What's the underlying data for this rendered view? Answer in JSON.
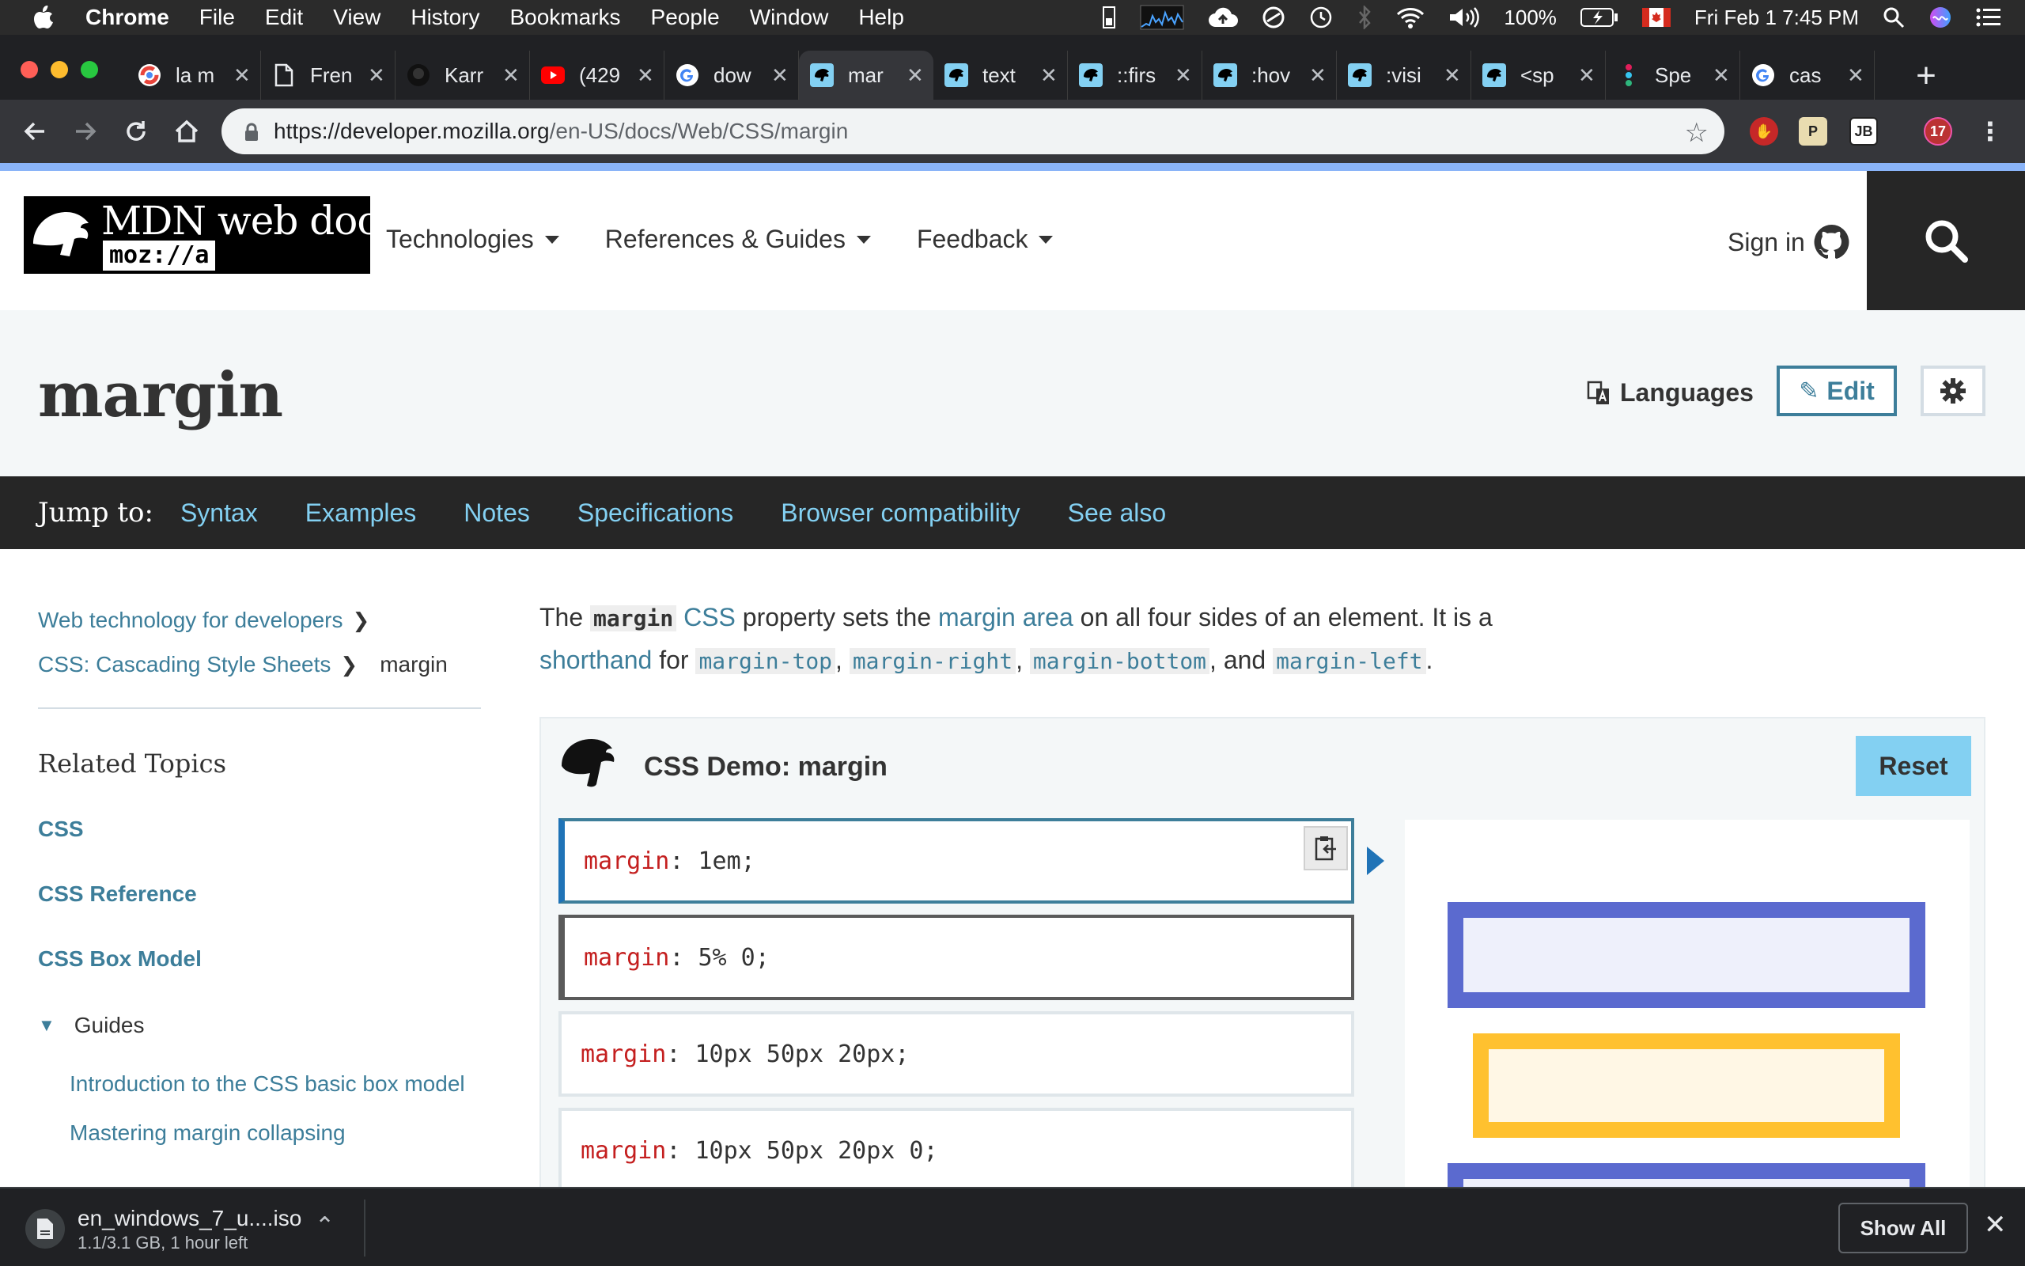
{
  "menubar": {
    "app_name": "Chrome",
    "menus": [
      "File",
      "Edit",
      "View",
      "History",
      "Bookmarks",
      "People",
      "Window",
      "Help"
    ],
    "battery": "100%",
    "datetime": "Fri Feb 1  7:45 PM"
  },
  "tabs": [
    {
      "label": "la m",
      "icon": "chrome-icon"
    },
    {
      "label": "Fren",
      "icon": "document-icon"
    },
    {
      "label": "Karr",
      "icon": "github-icon"
    },
    {
      "label": "(429",
      "icon": "youtube-icon"
    },
    {
      "label": "dow",
      "icon": "google-icon"
    },
    {
      "label": "mar",
      "icon": "mdn-icon",
      "active": true
    },
    {
      "label": "text",
      "icon": "mdn-icon"
    },
    {
      "label": "::firs",
      "icon": "mdn-icon"
    },
    {
      "label": ":hov",
      "icon": "mdn-icon"
    },
    {
      "label": ":visi",
      "icon": "mdn-icon"
    },
    {
      "label": "<sp",
      "icon": "mdn-icon"
    },
    {
      "label": "Spe",
      "icon": "slack-icon"
    },
    {
      "label": "cas",
      "icon": "google-icon"
    }
  ],
  "address": {
    "host": "https://developer.mozilla.org",
    "path": "/en-US/docs/Web/CSS/margin"
  },
  "extensions": {
    "badge_count": "17",
    "p_label": "P",
    "jb_label": "JB"
  },
  "header": {
    "logo_text": "MDN web docs",
    "logo_sub": "moz://a",
    "nav": [
      "Technologies",
      "References & Guides",
      "Feedback"
    ],
    "signin": "Sign in"
  },
  "title_area": {
    "title": "margin",
    "languages": "Languages",
    "edit": "Edit"
  },
  "jump": {
    "label": "Jump to:",
    "links": [
      "Syntax",
      "Examples",
      "Notes",
      "Specifications",
      "Browser compatibility",
      "See also"
    ]
  },
  "sidebar": {
    "breadcrumbs": [
      "Web technology for developers",
      "CSS: Cascading Style Sheets"
    ],
    "current": "margin",
    "related_heading": "Related Topics",
    "links": [
      "CSS",
      "CSS Reference",
      "CSS Box Model"
    ],
    "guides_label": "Guides",
    "guides": [
      "Introduction to the CSS basic box model",
      "Mastering margin collapsing"
    ]
  },
  "intro": {
    "t1": "The ",
    "code_margin": "margin",
    "t2": " ",
    "link_css": "CSS",
    "t3": " property sets the ",
    "link_area": "margin area",
    "t4": " on all four sides of an element. It is a ",
    "link_shorthand": "shorthand",
    "t5": " for ",
    "c1": "margin-top",
    "sep1": ", ",
    "c2": "margin-right",
    "sep2": ", ",
    "c3": "margin-bottom",
    "sep3": ", and ",
    "c4": "margin-left",
    "t6": "."
  },
  "demo": {
    "title": "CSS Demo: margin",
    "reset": "Reset",
    "choices": [
      {
        "prop": "margin",
        "value": " 1em;"
      },
      {
        "prop": "margin",
        "value": " 5% 0;"
      },
      {
        "prop": "margin",
        "value": " 10px 50px 20px;"
      },
      {
        "prop": "margin",
        "value": " 10px 50px 20px 0;"
      }
    ],
    "colors": {
      "blue": "#5b6acf",
      "yellow": "#ffc12f"
    }
  },
  "downloads": {
    "file": "en_windows_7_u....iso",
    "status": "1.1/3.1 GB, 1 hour left",
    "show_all": "Show All"
  }
}
